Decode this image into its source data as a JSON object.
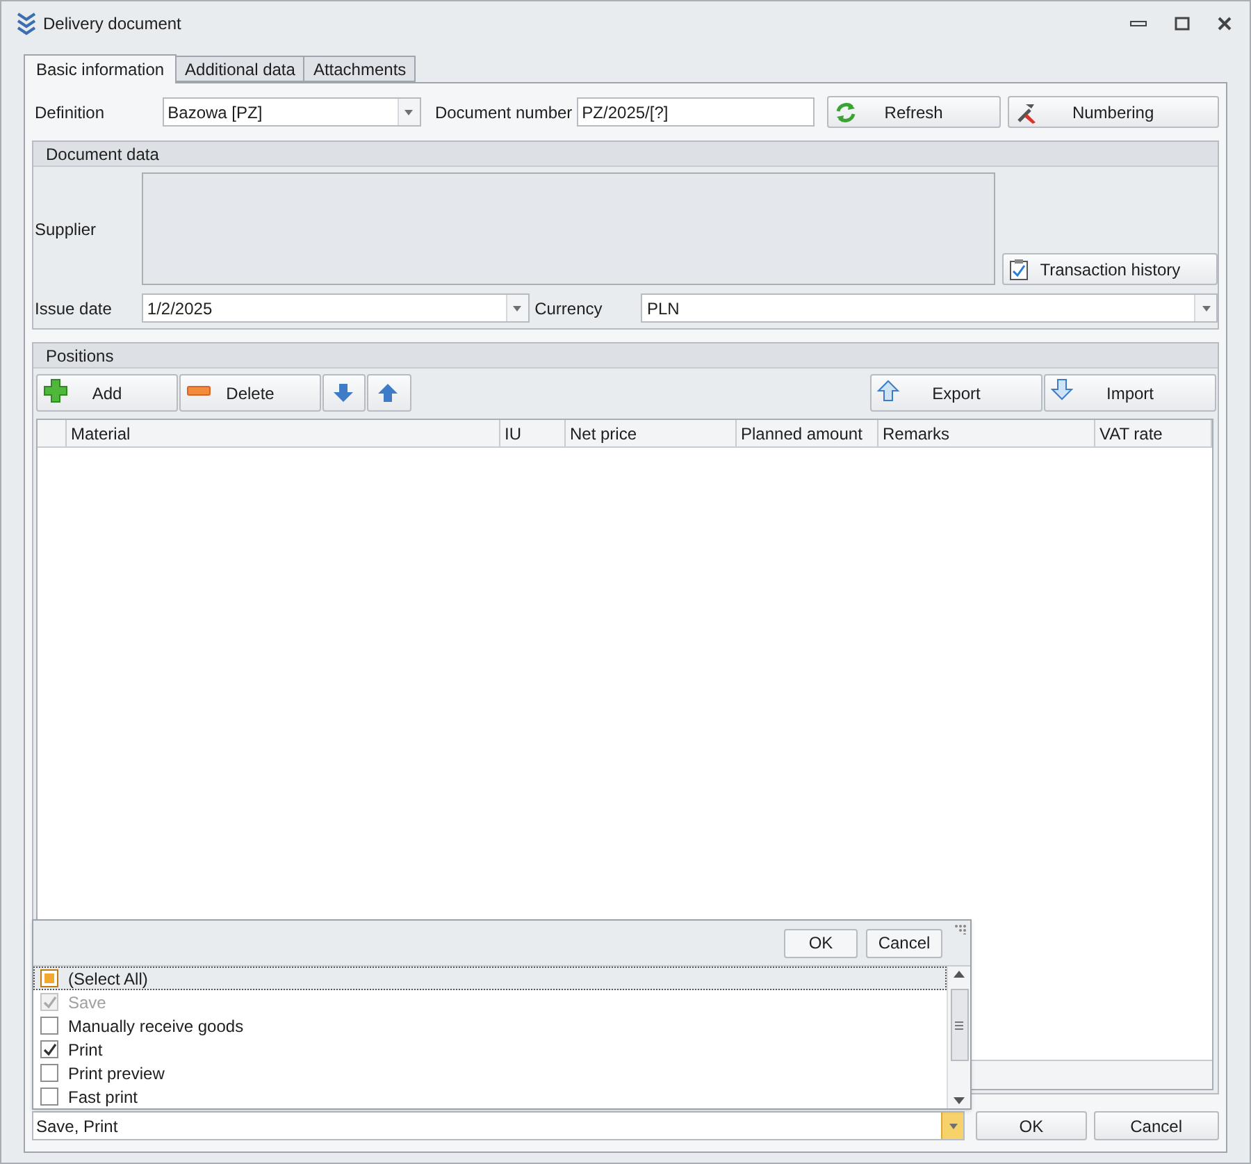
{
  "window": {
    "title": "Delivery document"
  },
  "tabs": [
    {
      "label": "Basic information",
      "selected": true
    },
    {
      "label": "Additional data",
      "selected": false
    },
    {
      "label": "Attachments",
      "selected": false
    }
  ],
  "definition": {
    "label": "Definition",
    "value": "Bazowa [PZ]"
  },
  "document_number": {
    "label": "Document number",
    "value": "PZ/2025/[?]"
  },
  "header_buttons": [
    {
      "kind": "refresh",
      "label": "Refresh"
    },
    {
      "kind": "numbering",
      "label": "Numbering"
    }
  ],
  "document_data": {
    "title": "Document data",
    "supplier_label": "Supplier",
    "transaction_history": "Transaction history",
    "issue_date": {
      "label": "Issue date",
      "value": "1/2/2025"
    },
    "currency": {
      "label": "Currency",
      "value": "PLN"
    }
  },
  "positions": {
    "title": "Positions",
    "toolbar": [
      {
        "kind": "add",
        "label": "Add"
      },
      {
        "kind": "delete",
        "label": "Delete"
      },
      {
        "kind": "down"
      },
      {
        "kind": "up"
      },
      {
        "kind": "export",
        "label": "Export"
      },
      {
        "kind": "import",
        "label": "Import"
      }
    ],
    "columns": [
      "Material",
      "IU",
      "Net price",
      "Planned amount",
      "Remarks",
      "VAT rate"
    ]
  },
  "actions_dropdown": {
    "ok": "OK",
    "cancel": "Cancel",
    "select_all": {
      "label": "(Select All)",
      "partial": true
    },
    "items": [
      {
        "label": "Save",
        "checked": true,
        "disabled": true
      },
      {
        "label": "Manually receive goods",
        "checked": false,
        "disabled": false
      },
      {
        "label": "Print",
        "checked": true,
        "disabled": false
      },
      {
        "label": "Print preview",
        "checked": false,
        "disabled": false
      },
      {
        "label": "Fast print",
        "checked": false,
        "disabled": false
      }
    ],
    "value": "Save, Print"
  },
  "footer_buttons": [
    "OK",
    "Cancel"
  ]
}
